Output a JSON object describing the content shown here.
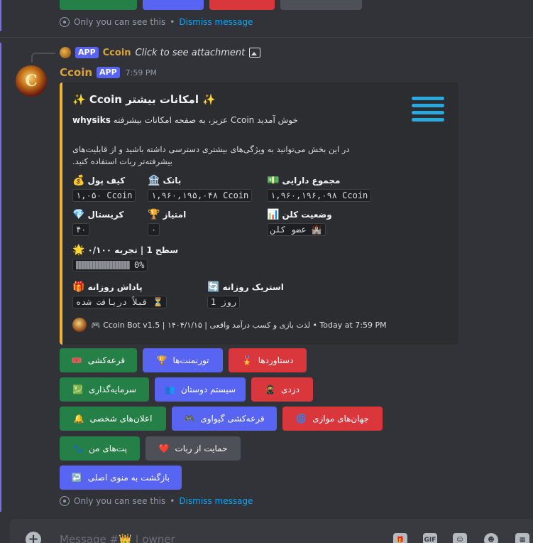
{
  "top_message": {
    "notice": "Only you can see this",
    "separator": "•",
    "dismiss": "Dismiss message"
  },
  "reply": {
    "badge": "APP",
    "author": "Ccoin",
    "text": "Click to see attachment"
  },
  "message": {
    "author": "Ccoin",
    "badge": "APP",
    "time": "7:59 PM",
    "avatar_letter": "C"
  },
  "embed": {
    "title": "✨ امکانات بیشتر Ccoin ✨",
    "welcome_user": "whysiks",
    "welcome_text": "خوش آمدید Ccoin عزیز، به صفحه امکانات بیشرفته",
    "description": "در این بخش می‌توانید به ویژگی‌های بیشتری دسترسی داشته باشید و از قابلیت‌های بیشرفته‌تر ربات استفاده کنید.",
    "fields": [
      {
        "emoji": "💰",
        "name": "کیف پول",
        "value": "۱,۰۵۰ Ccoin"
      },
      {
        "emoji": "🏦",
        "name": "بانک",
        "value": "۱,۹۶۰,۱۹۵,۰۴۸ Ccoin"
      },
      {
        "emoji": "💵",
        "name": "مجموع دارایی",
        "value": "۱,۹۶۰,۱۹۶,۰۹۸ Ccoin"
      },
      {
        "emoji": "💎",
        "name": "کریستال",
        "value": "۴۰"
      },
      {
        "emoji": "🏆",
        "name": "امتیاز",
        "value": "۰"
      },
      {
        "emoji": "📊",
        "name": "وضعیت کلن",
        "value": "🏰 عضو کلن"
      }
    ],
    "level": {
      "emoji": "🌟",
      "name": "سطح 1 | تجربه ۰/۱۰۰",
      "progress": 0,
      "progress_text": "0%"
    },
    "daily": {
      "emoji": "🎁",
      "name": "پاداش روزانه",
      "value": "⏳ قبلاً دریافت شده"
    },
    "streak": {
      "emoji": "🔄",
      "name": "استریک روزانه",
      "value": "1 روز"
    },
    "footer": "🎮 Ccoin Bot v1.5 | لذت بازی و کسب درآمد واقعی | ۱۴۰۴/۱/۱۵ • Today at 7:59 PM"
  },
  "buttons": [
    {
      "label": "قرعه‌کشی",
      "emoji": "🎟️"
    },
    {
      "label": "تورنمنت‌ها",
      "emoji": "🏆"
    },
    {
      "label": "دستاوردها",
      "emoji": "🎖️"
    },
    {
      "label": "سرمایه‌گذاری",
      "emoji": "💹"
    },
    {
      "label": "سیستم دوستان",
      "emoji": "👥"
    },
    {
      "label": "دزدی",
      "emoji": "🥷"
    },
    {
      "label": "اعلان‌های شخصی",
      "emoji": "🔔"
    },
    {
      "label": "قرعه‌کشی گیواوی",
      "emoji": "🎮"
    },
    {
      "label": "جهان‌های موازی",
      "emoji": "🌀"
    },
    {
      "label": "پت‌های من",
      "emoji": "🐾"
    },
    {
      "label": "حمایت از ربات",
      "emoji": "❤️"
    },
    {
      "label": "بازگشت به منوی اصلی",
      "emoji": "↩️"
    }
  ],
  "bottom_notice": {
    "notice": "Only you can see this",
    "separator": "•",
    "dismiss": "Dismiss message"
  },
  "composer": {
    "placeholder": "Message #👑 | owner",
    "gif_label": "GIF"
  },
  "colors": {
    "background": "#313338",
    "embed_bg": "#2b2d31",
    "embed_accent": "#f0b232",
    "green": "#248046",
    "blurple": "#5865f2",
    "red": "#da373c",
    "gray": "#4e5058",
    "link": "#00a8fc",
    "author_gold": "#d8a437"
  }
}
